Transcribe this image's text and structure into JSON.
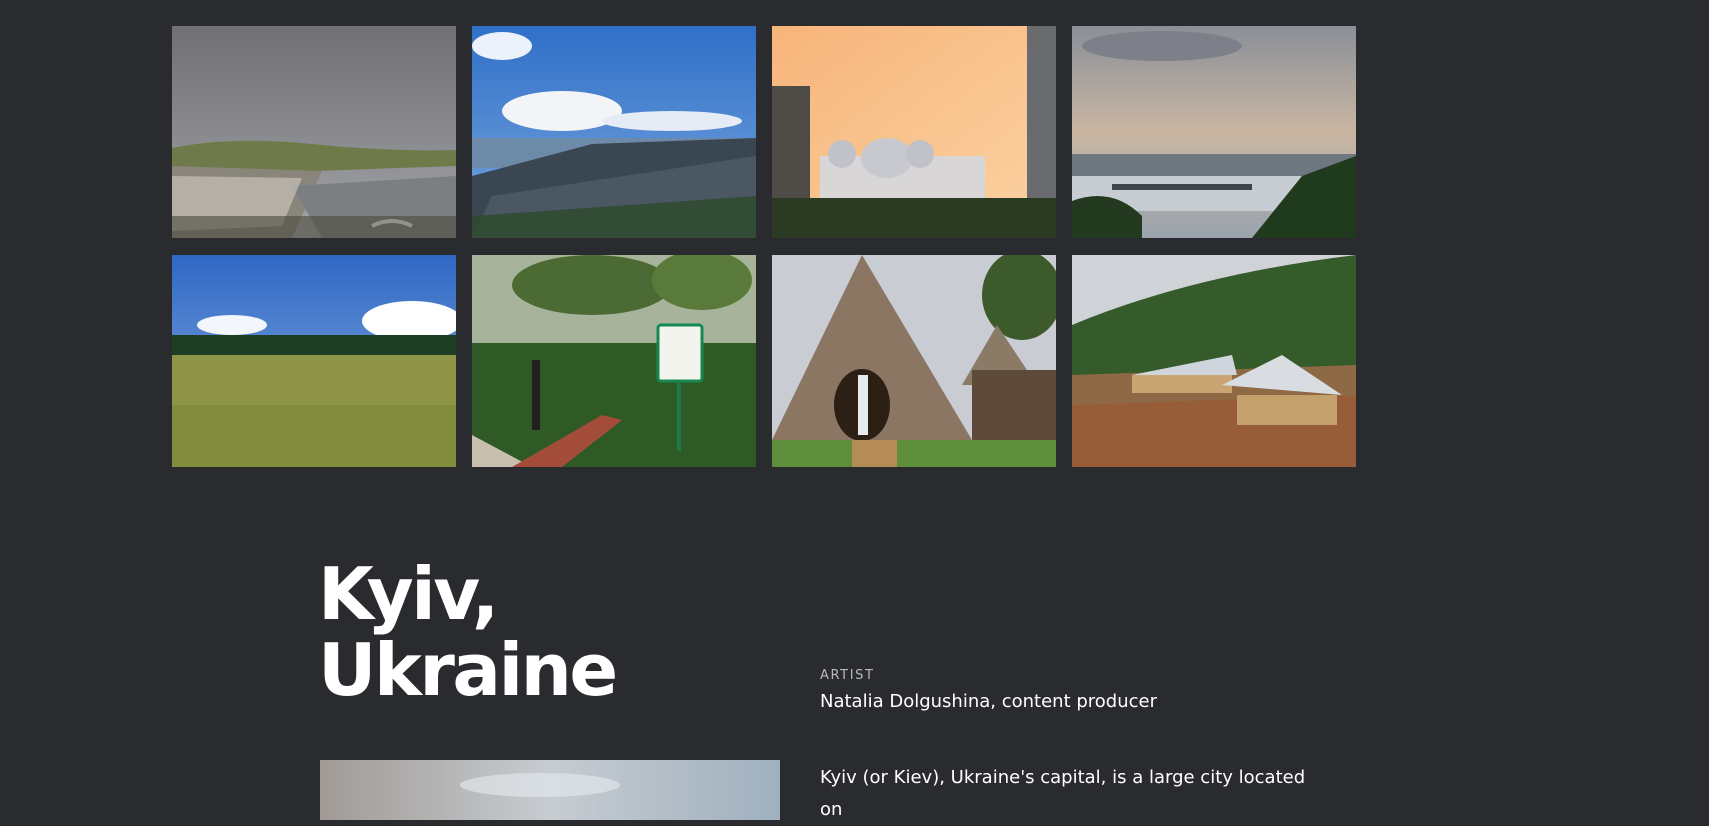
{
  "gallery": {
    "photos": [
      {
        "subject": "coastal-town-cloudy"
      },
      {
        "subject": "seaside-town-blue-sky"
      },
      {
        "subject": "church-sunset"
      },
      {
        "subject": "city-river-bridge"
      },
      {
        "subject": "grass-field"
      },
      {
        "subject": "garden-green-sign"
      },
      {
        "subject": "thatched-hut"
      },
      {
        "subject": "hillside-houses"
      }
    ]
  },
  "location": {
    "title_line1": "Kyiv,",
    "title_line2": "Ukraine"
  },
  "artist": {
    "label": "ARTIST",
    "name": "Natalia Dolgushina, content producer"
  },
  "description": {
    "line1": "Kyiv (or Kiev), Ukraine's capital, is a large city located on"
  },
  "colors": {
    "background": "#2a2b2f",
    "text": "#ffffff",
    "label": "#b8b9bd"
  }
}
